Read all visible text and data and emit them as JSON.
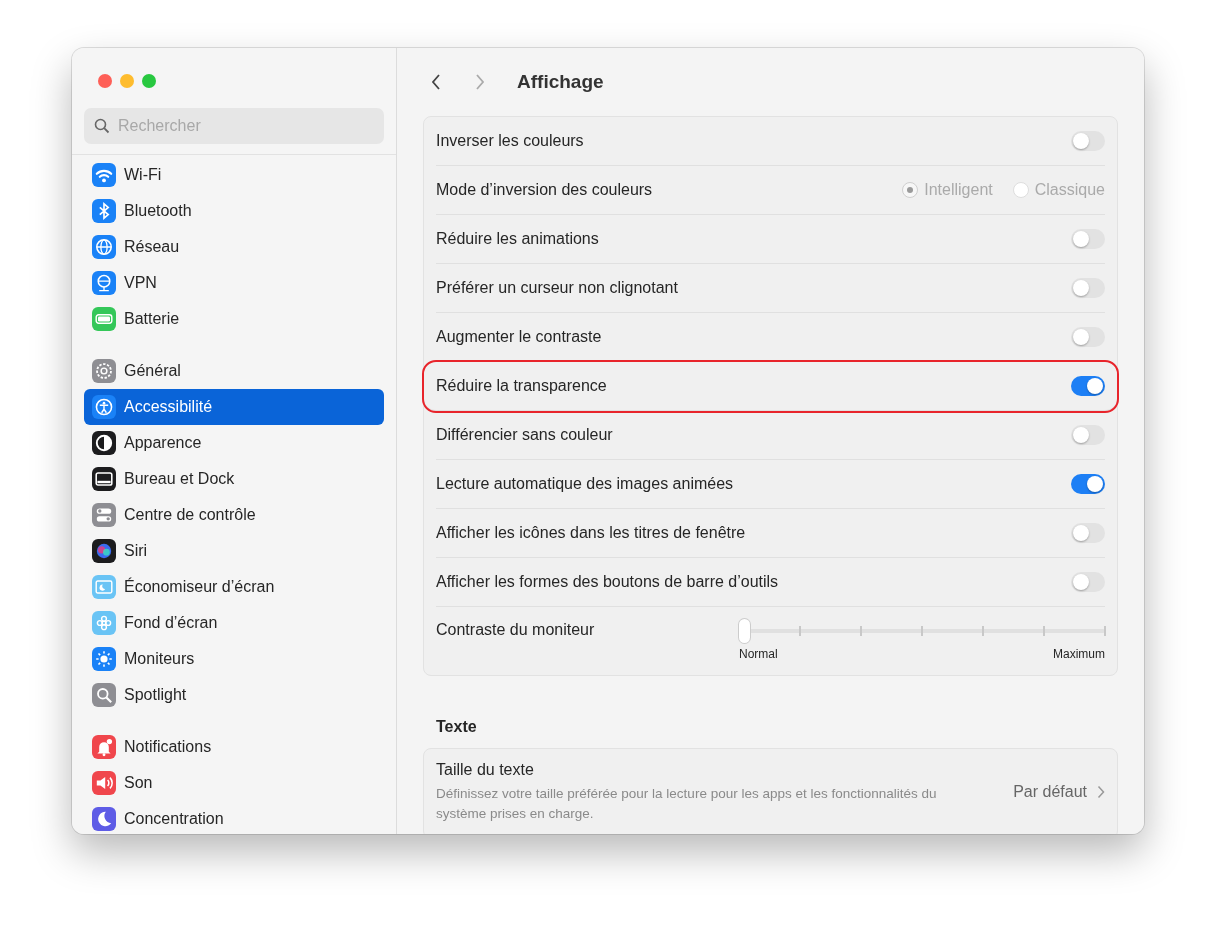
{
  "window": {
    "title": "Affichage"
  },
  "search": {
    "placeholder": "Rechercher"
  },
  "sidebar": {
    "groups": [
      [
        {
          "label": "Wi-Fi",
          "kind": "wifi",
          "color": "#1a82f7",
          "selected": false
        },
        {
          "label": "Bluetooth",
          "kind": "bluetooth",
          "color": "#1a82f7",
          "selected": false
        },
        {
          "label": "Réseau",
          "kind": "globe",
          "color": "#1a82f7",
          "selected": false
        },
        {
          "label": "VPN",
          "kind": "vpn",
          "color": "#1a82f7",
          "selected": false
        },
        {
          "label": "Batterie",
          "kind": "battery",
          "color": "#34c759",
          "selected": false
        }
      ],
      [
        {
          "label": "Général",
          "kind": "gear",
          "color": "#8e8e93",
          "selected": false
        },
        {
          "label": "Accessibilité",
          "kind": "accessibility",
          "color": "#1a82f7",
          "selected": true
        },
        {
          "label": "Apparence",
          "kind": "appearance",
          "color": "#1c1c1e",
          "selected": false
        },
        {
          "label": "Bureau et Dock",
          "kind": "dock",
          "color": "#1c1c1e",
          "selected": false
        },
        {
          "label": "Centre de contrôle",
          "kind": "switches",
          "color": "#8e8e93",
          "selected": false
        },
        {
          "label": "Siri",
          "kind": "siri",
          "color": "#1c1c1e",
          "selected": false
        },
        {
          "label": "Économiseur d’écran",
          "kind": "screensaver",
          "color": "#6ac4f5",
          "selected": false
        },
        {
          "label": "Fond d’écran",
          "kind": "flower",
          "color": "#6ac4f5",
          "selected": false
        },
        {
          "label": "Moniteurs",
          "kind": "sun",
          "color": "#1a82f7",
          "selected": false
        },
        {
          "label": "Spotlight",
          "kind": "magnifier",
          "color": "#8e8e93",
          "selected": false
        }
      ],
      [
        {
          "label": "Notifications",
          "kind": "bell",
          "color": "#f0464c",
          "selected": false
        },
        {
          "label": "Son",
          "kind": "speaker",
          "color": "#f0464c",
          "selected": false
        },
        {
          "label": "Concentration",
          "kind": "moon",
          "color": "#5e5ce6",
          "selected": false
        }
      ]
    ]
  },
  "settings": [
    {
      "kind": "toggle",
      "label": "Inverser les couleurs",
      "on": false,
      "highlighted": false
    },
    {
      "kind": "radio",
      "label": "Mode d’inversion des couleurs",
      "disabled": true,
      "highlighted": false,
      "options": [
        {
          "label": "Intelligent",
          "selected": true
        },
        {
          "label": "Classique",
          "selected": false
        }
      ]
    },
    {
      "kind": "toggle",
      "label": "Réduire les animations",
      "on": false,
      "highlighted": false
    },
    {
      "kind": "toggle",
      "label": "Préférer un curseur non clignotant",
      "on": false,
      "highlighted": false
    },
    {
      "kind": "toggle",
      "label": "Augmenter le contraste",
      "on": false,
      "highlighted": false
    },
    {
      "kind": "toggle",
      "label": "Réduire la transparence",
      "on": true,
      "highlighted": true
    },
    {
      "kind": "toggle",
      "label": "Différencier sans couleur",
      "on": false,
      "highlighted": false
    },
    {
      "kind": "toggle",
      "label": "Lecture automatique des images animées",
      "on": true,
      "highlighted": false
    },
    {
      "kind": "toggle",
      "label": "Afficher les icônes dans les titres de fenêtre",
      "on": false,
      "highlighted": false
    },
    {
      "kind": "toggle",
      "label": "Afficher les formes des boutons de barre d’outils",
      "on": false,
      "highlighted": false
    },
    {
      "kind": "slider",
      "label": "Contraste du moniteur",
      "level": 0,
      "min_label": "Normal",
      "max_label": "Maximum",
      "highlighted": false
    }
  ],
  "text_section": {
    "title": "Texte",
    "rows": [
      {
        "label": "Taille du texte",
        "description": "Définissez votre taille préférée pour la lecture pour les apps et les fonctionnalités du système prises en charge.",
        "value": "Par défaut"
      }
    ]
  }
}
